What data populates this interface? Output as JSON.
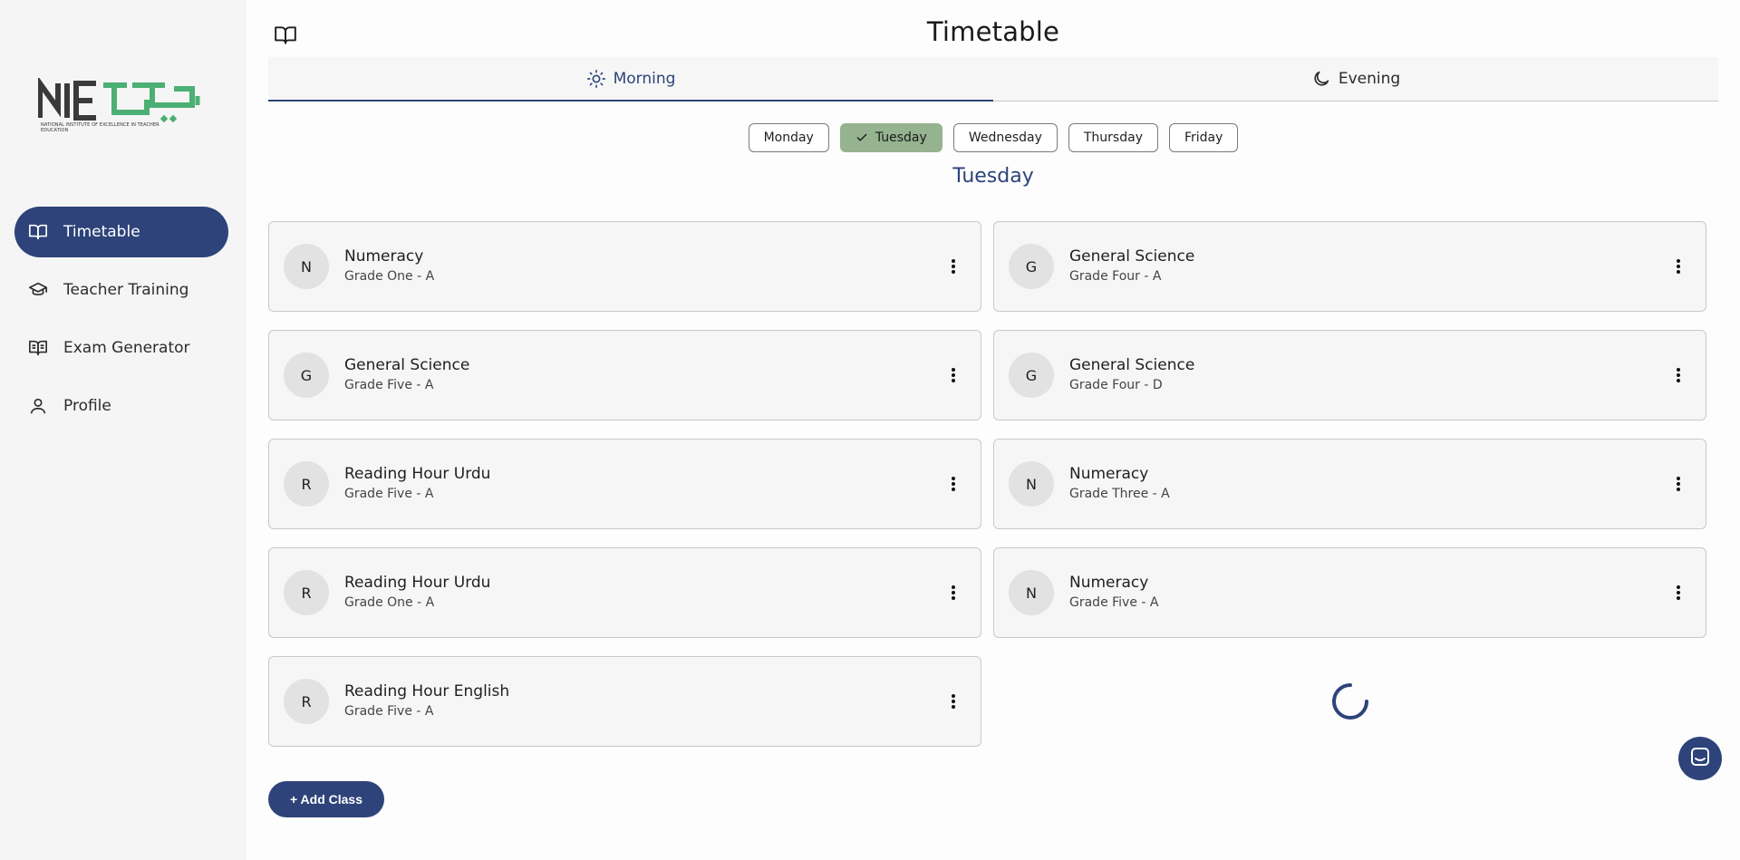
{
  "brand": {
    "logo_text": "NIETE",
    "logo_subtitle": "NATIONAL INSTITUTE OF EXCELLENCE IN TEACHER EDUCATION",
    "accent_color": "#2d4379",
    "logo_green": "#4caf73"
  },
  "sidebar": {
    "items": [
      {
        "label": "Timetable",
        "icon": "book-open-icon",
        "active": true
      },
      {
        "label": "Teacher Training",
        "icon": "graduation-cap-icon",
        "active": false
      },
      {
        "label": "Exam Generator",
        "icon": "book-text-icon",
        "active": false
      },
      {
        "label": "Profile",
        "icon": "user-icon",
        "active": false
      }
    ]
  },
  "header": {
    "title": "Timetable",
    "icon": "book-open-icon"
  },
  "tabs": [
    {
      "label": "Morning",
      "icon": "sun-icon",
      "active": true
    },
    {
      "label": "Evening",
      "icon": "moon-icon",
      "active": false
    }
  ],
  "days": {
    "items": [
      "Monday",
      "Tuesday",
      "Wednesday",
      "Thursday",
      "Friday"
    ],
    "selected": "Tuesday",
    "selected_color": "#95b38e"
  },
  "day_heading": "Tuesday",
  "classes": [
    {
      "initial": "N",
      "subject": "Numeracy",
      "grade": "Grade One - A"
    },
    {
      "initial": "G",
      "subject": "General Science",
      "grade": "Grade Four - A"
    },
    {
      "initial": "G",
      "subject": "General Science",
      "grade": "Grade Five - A"
    },
    {
      "initial": "G",
      "subject": "General Science",
      "grade": "Grade Four - D"
    },
    {
      "initial": "R",
      "subject": "Reading Hour Urdu",
      "grade": "Grade Five - A"
    },
    {
      "initial": "N",
      "subject": "Numeracy",
      "grade": "Grade Three - A"
    },
    {
      "initial": "R",
      "subject": "Reading Hour Urdu",
      "grade": "Grade One - A"
    },
    {
      "initial": "N",
      "subject": "Numeracy",
      "grade": "Grade Five - A"
    },
    {
      "initial": "R",
      "subject": "Reading Hour English",
      "grade": "Grade Five - A"
    }
  ],
  "add_class_label": "+ Add Class",
  "chat_icon": "chat-icon"
}
